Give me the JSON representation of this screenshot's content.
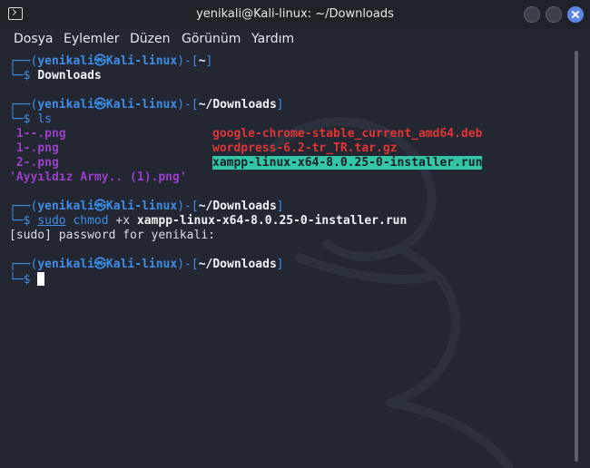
{
  "window": {
    "title": "yenikali@Kali-linux: ~/Downloads"
  },
  "menu": [
    "Dosya",
    "Eylemler",
    "Düzen",
    "Görünüm",
    "Yardım"
  ],
  "prompts": [
    {
      "left": "┌──(",
      "user": "yenikali㉿Kali-linux",
      "mid": ")-[",
      "path": "~",
      "right": "]",
      "dollar": "└─$",
      "cmd": "Downloads"
    },
    {
      "left": "┌──(",
      "user": "yenikali㉿Kali-linux",
      "mid": ")-[",
      "path": "~/Downloads",
      "right": "]",
      "dollar": "└─$",
      "cmd": "ls"
    },
    {
      "left": "┌──(",
      "user": "yenikali㉿Kali-linux",
      "mid": ")-[",
      "path": "~/Downloads",
      "right": "]",
      "dollar": "└─$",
      "sudo": "sudo",
      "chmod": "chmod",
      "arg": "+x",
      "file": "xampp-linux-x64-8.0.25-0-installer.run"
    },
    {
      "left": "┌──(",
      "user": "yenikali㉿Kali-linux",
      "mid": ")-[",
      "path": "~/Downloads",
      "right": "]",
      "dollar": "└─$"
    }
  ],
  "ls_output": {
    "col1": [
      " 1--.png",
      " 1-.png",
      " 2-.png"
    ],
    "col2": [
      "google-chrome-stable_current_amd64.deb",
      "wordpress-6.2-tr_TR.tar.gz",
      "xampp-linux-x64-8.0.25-0-installer.run"
    ],
    "last": "'Ayyıldız Army.. (1).png'"
  },
  "sudo_prompt": "[sudo] password for yenikali:"
}
